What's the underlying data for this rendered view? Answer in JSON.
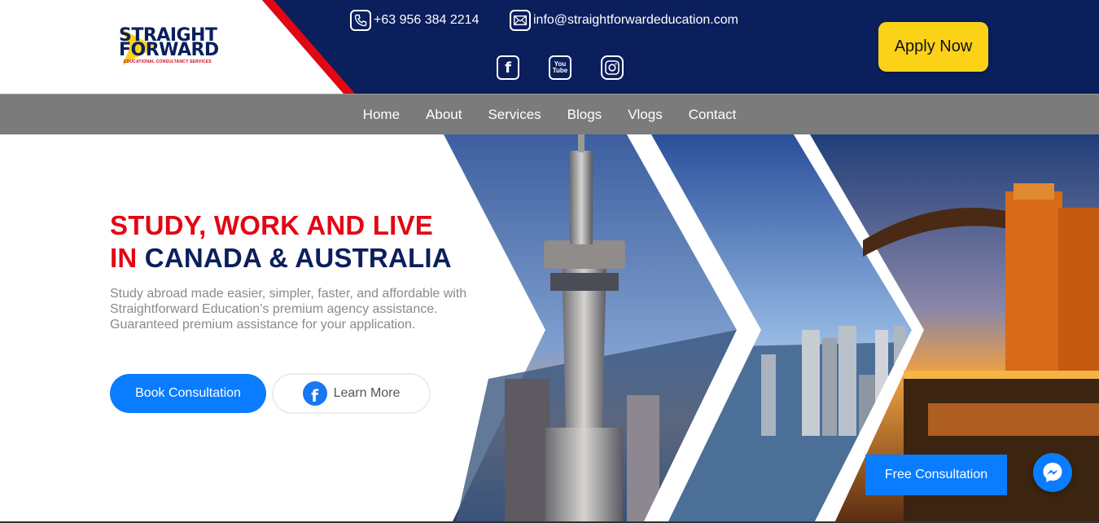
{
  "header": {
    "logo": {
      "line1": "STRAIGHT",
      "line2": "FORWARD",
      "tagline": "EDUCATIONAL CONSULTANCY SERVICES"
    },
    "phone": "+63 956 384 2214",
    "email": "info@straightforwardeducation.com",
    "socials": [
      {
        "name": "facebook-icon",
        "glyph": "f"
      },
      {
        "name": "youtube-icon",
        "glyph_top": "You",
        "glyph_bottom": "Tube"
      },
      {
        "name": "instagram-icon"
      }
    ],
    "apply_label": "Apply Now"
  },
  "nav": {
    "items": [
      {
        "label": "Home"
      },
      {
        "label": "About"
      },
      {
        "label": "Services"
      },
      {
        "label": "Blogs"
      },
      {
        "label": "Vlogs"
      },
      {
        "label": "Contact"
      }
    ]
  },
  "hero": {
    "headline_line1": "STUDY, WORK AND LIVE",
    "headline_in": "IN",
    "headline_rest": "CANADA & AUSTRALIA",
    "description": "Study abroad made easier, simpler, faster, and affordable with Straightforward Education’s premium agency assistance. Guaranteed premium assistance for your application.",
    "book_label": "Book Consultation",
    "learn_label": "Learn More"
  },
  "floating": {
    "free_consultation_label": "Free Consultation"
  },
  "colors": {
    "navy": "#0a1f5c",
    "red": "#e30613",
    "yellow": "#fcd219",
    "blue": "#0a7cff",
    "nav_gray": "#7b7b7b"
  }
}
